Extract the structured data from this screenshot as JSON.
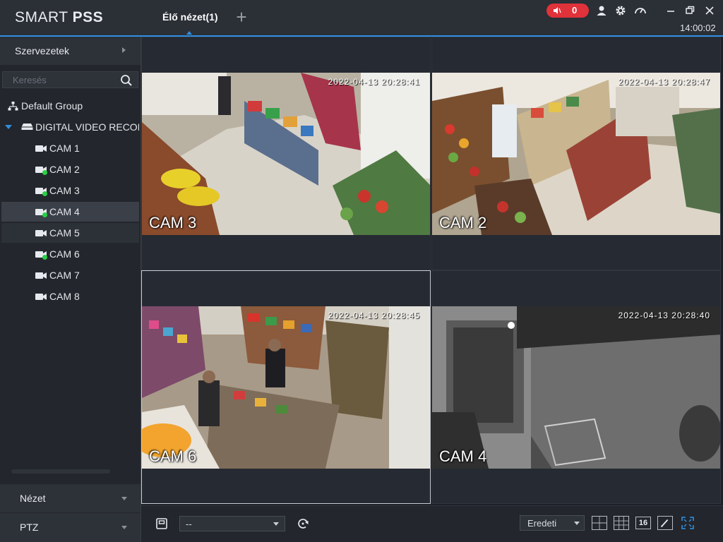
{
  "app": {
    "logo_light": "SMART ",
    "logo_bold": "PSS",
    "live_tab_label": "Élő nézet(1)",
    "add_tab_label": "+",
    "alarm_count": "0",
    "clock": "14:00:02"
  },
  "sidebar": {
    "organization_header": "Szervezetek",
    "search_placeholder": "Keresés",
    "tree": {
      "group": "Default Group",
      "device": "DIGITAL VIDEO RECORDER",
      "cameras": [
        {
          "label": "CAM 1",
          "online": false
        },
        {
          "label": "CAM 2",
          "online": true
        },
        {
          "label": "CAM 3",
          "online": true
        },
        {
          "label": "CAM 4",
          "online": true,
          "selected": true
        },
        {
          "label": "CAM 5",
          "online": false
        },
        {
          "label": "CAM 6",
          "online": true
        },
        {
          "label": "CAM 7",
          "online": false
        },
        {
          "label": "CAM 8",
          "online": false
        }
      ]
    },
    "view_header": "Nézet",
    "ptz_header": "PTZ"
  },
  "grid": {
    "cells": [
      {
        "label": "CAM 3",
        "timestamp": "2022-04-13 20:28:41"
      },
      {
        "label": "CAM 2",
        "timestamp": "2022-04-13 20:28:47"
      },
      {
        "label": "CAM 6",
        "timestamp": "2022-04-13 20:28:45"
      },
      {
        "label": "CAM 4",
        "timestamp": "2022-04-13 20:28:40"
      }
    ]
  },
  "toolbar": {
    "view_select_value": "--",
    "ratio_value": "Eredeti",
    "layout16_label": "16"
  },
  "colors": {
    "accent": "#2f8fe0",
    "alarm": "#e0323a",
    "online": "#28d046"
  }
}
